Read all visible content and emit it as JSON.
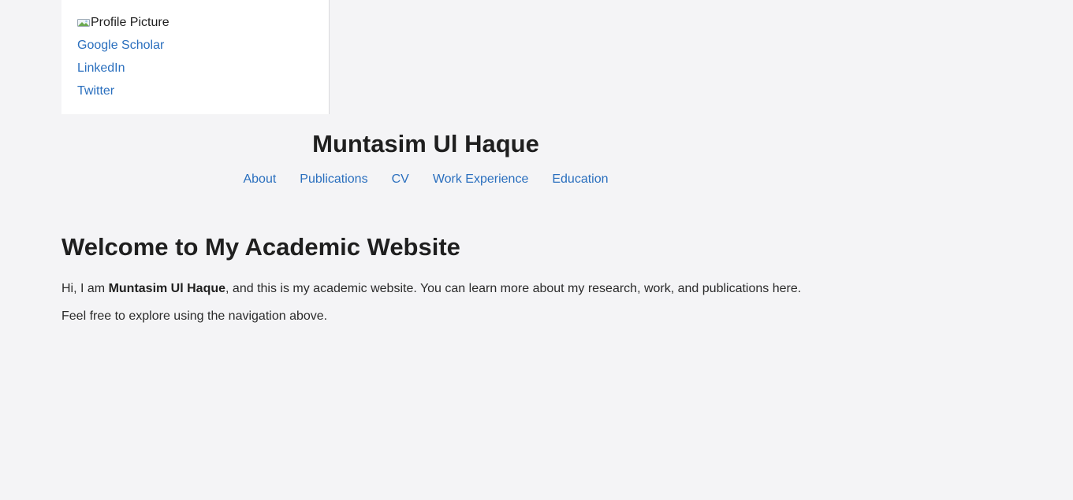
{
  "sidebar": {
    "profile_picture_alt": "Profile Picture",
    "links": [
      {
        "label": "Google Scholar"
      },
      {
        "label": "LinkedIn"
      },
      {
        "label": "Twitter"
      }
    ]
  },
  "header": {
    "title": "Muntasim Ul Haque",
    "nav": [
      {
        "label": "About"
      },
      {
        "label": "Publications"
      },
      {
        "label": "CV"
      },
      {
        "label": "Work Experience"
      },
      {
        "label": "Education"
      }
    ]
  },
  "main": {
    "heading": "Welcome to My Academic Website",
    "intro_prefix": "Hi, I am ",
    "intro_name": "Muntasim Ul Haque",
    "intro_suffix": ", and this is my academic website. You can learn more about my research, work, and publications here.",
    "explore_text": "Feel free to explore using the navigation above."
  },
  "colors": {
    "background": "#f4f4f6",
    "link": "#2a6fbe",
    "text": "#1f1f1f",
    "sidebar_bg": "#ffffff"
  }
}
